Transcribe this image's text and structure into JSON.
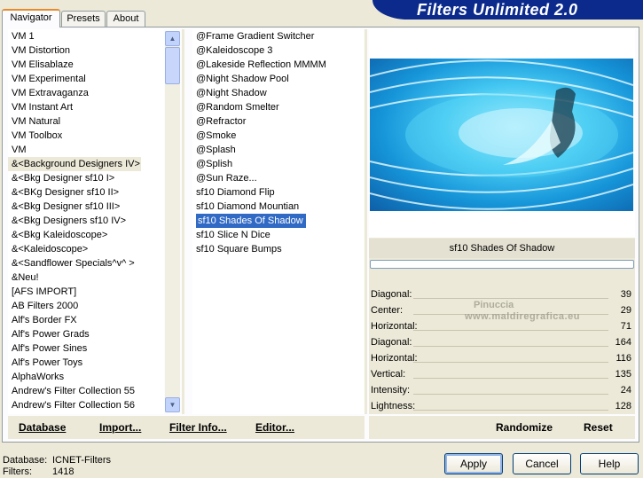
{
  "app_title": "Filters Unlimited 2.0",
  "tabs": [
    {
      "label": "Navigator"
    },
    {
      "label": "Presets"
    },
    {
      "label": "About"
    }
  ],
  "categories": [
    "VM 1",
    "VM Distortion",
    "VM Elisablaze",
    "VM Experimental",
    "VM Extravaganza",
    "VM Instant Art",
    "VM Natural",
    "VM Toolbox",
    "VM",
    "&<Background Designers IV>",
    "&<Bkg Designer sf10 I>",
    "&<BKg Designer sf10 II>",
    "&<Bkg Designer sf10 III>",
    "&<Bkg Designers sf10 IV>",
    "&<Bkg Kaleidoscope>",
    "&<Kaleidoscope>",
    "&<Sandflower Specials^v^ >",
    "&Neu!",
    "[AFS IMPORT]",
    "AB Filters 2000",
    "Alf's Border FX",
    "Alf's Power Grads",
    "Alf's Power Sines",
    "Alf's Power Toys",
    "AlphaWorks",
    "Andrew's Filter Collection 55",
    "Andrew's Filter Collection 56"
  ],
  "current_category_index": 9,
  "filters": [
    "@Frame Gradient Switcher",
    "@Kaleidoscope 3",
    "@Lakeside Reflection MMMM",
    "@Night Shadow Pool",
    "@Night Shadow",
    "@Random Smelter",
    "@Refractor",
    "@Smoke",
    "@Splash",
    "@Splish",
    "@Sun Raze...",
    "sf10 Diamond Flip",
    "sf10 Diamond Mountian",
    "sf10 Shades Of Shadow",
    "sf10 Slice N Dice",
    "sf10 Square Bumps"
  ],
  "selected_filter_index": 13,
  "selected_filter_name": "sf10 Shades Of Shadow",
  "watermark": {
    "line1": "Pinuccia",
    "line2": "www.maldiregrafica.eu"
  },
  "params": [
    {
      "label": "Diagonal:",
      "value": "39"
    },
    {
      "label": "Center:",
      "value": "29"
    },
    {
      "label": "Horizontal:",
      "value": "71"
    },
    {
      "label": "Diagonal:",
      "value": "164"
    },
    {
      "label": "Horizontal:",
      "value": "116"
    },
    {
      "label": "Vertical:",
      "value": "135"
    },
    {
      "label": "Intensity:",
      "value": "24"
    },
    {
      "label": "Lightness:",
      "value": "128"
    }
  ],
  "left_buttons": {
    "database": "Database",
    "import": "Import...",
    "filter_info": "Filter Info...",
    "editor": "Editor..."
  },
  "right_buttons": {
    "randomize": "Randomize",
    "reset": "Reset"
  },
  "status": {
    "database_label": "Database:",
    "database_value": "ICNET-Filters",
    "filters_label": "Filters:",
    "filters_value": "1418"
  },
  "dialog_buttons": {
    "apply": "Apply",
    "cancel": "Cancel",
    "help": "Help"
  },
  "colors": {
    "accent": "#0b2a8c",
    "selection": "#316ac5",
    "tab_highlight": "#e68b2c"
  }
}
